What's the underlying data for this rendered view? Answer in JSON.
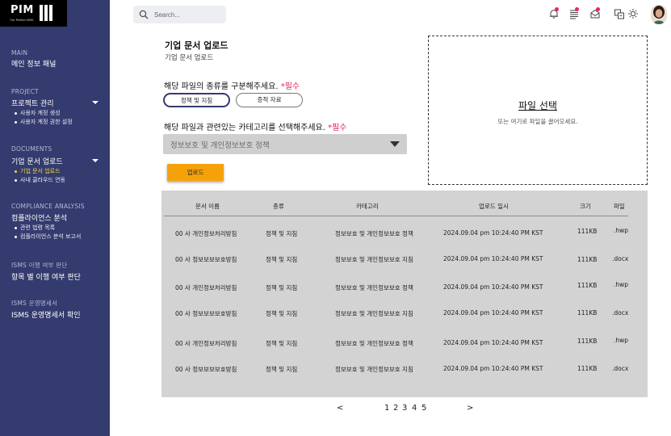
{
  "sidebar": {
    "logo": {
      "text": "PIM",
      "subtext": "For Perfect ISMS"
    },
    "sections": [
      {
        "label": "MAIN",
        "title": "메인 정보 패널",
        "items": []
      },
      {
        "label": "PROJECT",
        "title": "프로젝트 관리",
        "items": [
          "사용자 계정 생성",
          "사용자 계정 권한 설정"
        ]
      },
      {
        "label": "DOCUMENTS",
        "title": "기업 문서 업로드",
        "items": [
          "기업 문서 업로드",
          "사내 클라우드 연동"
        ]
      },
      {
        "label": "COMPLIANCE ANALYSIS",
        "title": "컴플라이언스 분석",
        "items": [
          "관련 법령 목록",
          "컴플라이언스 분석 보고서"
        ]
      },
      {
        "label": "ISMS 이행 여부 판단",
        "title": "항목 별 이행 여부 판단",
        "items": []
      },
      {
        "label": "ISMS 운영명세서",
        "title": "ISMS 운영명세서 확인",
        "items": []
      }
    ]
  },
  "topbar": {
    "search_placeholder": "Search...",
    "icons": [
      "bell-icon",
      "checklist-icon",
      "mail-icon",
      "translate-icon",
      "brightness-icon"
    ]
  },
  "page": {
    "title": "기업 문서 업로드",
    "breadcrumb": "기업 문서 업로드"
  },
  "form": {
    "type_question": "해당 파일의 종류를 구분해주세요.",
    "category_question": "해당 파일과 관련있는 카테고리를 선택해주세요.",
    "required": "*필수",
    "types": [
      "정책 및 지침",
      "증적 자료"
    ],
    "category_value": "정보보호 및 개인정보보호 정책",
    "upload_label": "업로드"
  },
  "dropzone": {
    "title": "파일 선택",
    "subtitle": "또는 여기로 파일을 끌어오세요."
  },
  "table": {
    "headers": [
      "문서 이름",
      "종류",
      "카테고리",
      "업로드 일시",
      "크기",
      "파일"
    ],
    "rows": [
      [
        "00 사 개인정보처리방침",
        "정책 및 지침",
        "정보보호 및 개인정보보호 정책",
        "2024.09.04 pm 10:24:40 PM KST",
        "111KB",
        ".hwp"
      ],
      [
        "00 사 정보보보보호방침",
        "정책 및 지침",
        "정보보호 및 개인정보보호 지침",
        "2024.09.04 pm 10:24:40 PM KST",
        "111KB",
        ".docx"
      ],
      [
        "00 사 개인정보처리방침",
        "정책 및 지침",
        "정보보호 및 개인정보보호 정책",
        "2024.09.04 pm 10:24:40 PM KST",
        "111KB",
        ".hwp"
      ],
      [
        "00 사 정보보보보호방침",
        "정책 및 지침",
        "정보보호 및 개인정보보호 지침",
        "2024.09.04 pm 10:24:40 PM KST",
        "111KB",
        ".docx"
      ],
      [
        "00 사 개인정보처리방침",
        "정책 및 지침",
        "정보보호 및 개인정보보호 정책",
        "2024.09.04 pm 10:24:40 PM KST",
        "111KB",
        ".hwp"
      ],
      [
        "00 사 정보보보보호방침",
        "정책 및 지침",
        "정보보호 및 개인정보보호 지침",
        "2024.09.04 pm 10:24:40 PM KST",
        "111KB",
        ".docx"
      ]
    ]
  },
  "pagination": {
    "prev": "<",
    "pages": [
      "1",
      "2",
      "3",
      "4",
      "5"
    ],
    "next": ">"
  },
  "colors": {
    "sidebar_bg": "#343b6e",
    "accent_yellow": "#f2d34b",
    "required_red": "#e0284f",
    "upload_orange": "#f5a20a",
    "table_bg": "#d3d3d3",
    "notification_dot": "#e5285a"
  }
}
